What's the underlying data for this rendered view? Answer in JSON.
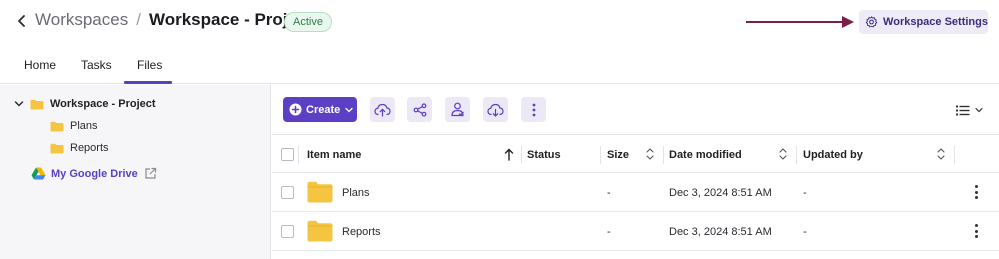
{
  "header": {
    "back_icon": "chevron-left-icon",
    "breadcrumb_parent": "Workspaces",
    "breadcrumb_separator": "/",
    "breadcrumb_current": "Workspace - Project",
    "status_badge": "Active",
    "settings_button_label": "Workspace Settings",
    "settings_icon": "gear-icon"
  },
  "tabs": [
    {
      "label": "Home",
      "active": false
    },
    {
      "label": "Tasks",
      "active": false
    },
    {
      "label": "Files",
      "active": true
    }
  ],
  "sidebar": {
    "root": {
      "label": "Workspace - Project",
      "expanded": true
    },
    "children": [
      {
        "label": "Plans"
      },
      {
        "label": "Reports"
      }
    ],
    "google_drive_label": "My Google Drive"
  },
  "toolbar": {
    "create_label": "Create",
    "icons": [
      "cloud-upload-icon",
      "share-icon",
      "user-access-icon",
      "cloud-download-icon",
      "more-vertical-icon"
    ],
    "view_icon": "list-view-icon"
  },
  "table": {
    "columns": [
      "Item name",
      "Status",
      "Size",
      "Date modified",
      "Updated by"
    ],
    "rows": [
      {
        "name": "Plans",
        "status": "",
        "size": "-",
        "date_modified": "Dec 3, 2024 8:51 AM",
        "updated_by": "-"
      },
      {
        "name": "Reports",
        "status": "",
        "size": "-",
        "date_modified": "Dec 3, 2024 8:51 AM",
        "updated_by": "-"
      }
    ]
  },
  "colors": {
    "accent": "#5b3fc4",
    "annotation_arrow": "#7a1f4a",
    "folder": "#f5c542",
    "badge_bg": "#eaf7ee",
    "badge_text": "#2e7d46"
  }
}
